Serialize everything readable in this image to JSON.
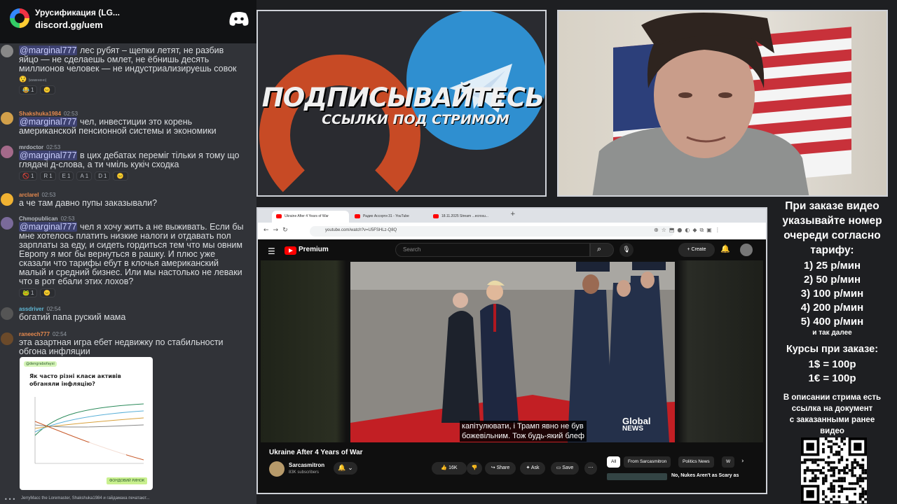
{
  "server": {
    "name": "Урусификация (LG...",
    "invite": "discord.gg/uem"
  },
  "messages": [
    {
      "user": "",
      "time": "",
      "name_color": "#b5bac1",
      "avatar_color": "#888888",
      "mention": "@marginal777",
      "lines": [
        "лес рубят – щепки летят, не разбив",
        "яйцо — не сделаешь омлет, не ёбнишь десять",
        "миллионов человек — не индустриализируешь совок"
      ],
      "note": "(изменено)",
      "reactions": [
        {
          "emoji": "😂",
          "count": "1"
        },
        {
          "emoji": "😐",
          "count": ""
        }
      ]
    },
    {
      "user": "Shakshuka1984",
      "time": "02:53",
      "name_color": "#e78a4e",
      "avatar_color": "#d2a04a",
      "mention": "@marginal777",
      "lines": [
        "чел, инвестиции это корень",
        "американской пенсионной системы и экономики"
      ],
      "reactions": []
    },
    {
      "user": "mrdoctor",
      "time": "02:53",
      "name_color": "#b5bac1",
      "avatar_color": "#a46a8a",
      "mention": "@marginal777",
      "lines": [
        "в цих дебатах переміг тільки я тому що",
        "глядачі д-слова, а ти чміль кукіч сходка"
      ],
      "reactions": [
        {
          "emoji": "🚫",
          "count": "1"
        },
        {
          "emoji": "R",
          "count": "1"
        },
        {
          "emoji": "E",
          "count": "1"
        },
        {
          "emoji": "A",
          "count": "1"
        },
        {
          "emoji": "D",
          "count": "1"
        },
        {
          "emoji": "😐",
          "count": ""
        }
      ]
    },
    {
      "user": "arclarel",
      "time": "02:53",
      "name_color": "#e78a4e",
      "avatar_color": "#f0b232",
      "mention": "",
      "lines": [
        "а че там давно пупы заказывали?"
      ],
      "reactions": []
    },
    {
      "user": "Chmopublican",
      "time": "02:53",
      "name_color": "#b5bac1",
      "avatar_color": "#7a6a9a",
      "mention": "@marginal777",
      "lines": [
        "чел я хочу жить а не выживать. Если бы",
        "мне хотелось платить низкие налоги и отдавать пол",
        "зарплаты за еду, и сидеть гордиться тем что мы овним",
        "Европу я мог бы вернуться в рашку. И плюс уже",
        "сказали что тарифы ебут в клочья американский",
        "малый и средний бизнес. Или мы настолько не леваки",
        "что в рот ебали этих лохов?"
      ],
      "reactions": [
        {
          "emoji": "🐸",
          "count": "1"
        },
        {
          "emoji": "😐",
          "count": ""
        }
      ]
    },
    {
      "user": "assdriver",
      "time": "02:54",
      "name_color": "#5fb8d6",
      "avatar_color": "#555555",
      "mention": "",
      "lines": [
        "богатий папа руский мама"
      ],
      "reactions": []
    },
    {
      "user": "raneech777",
      "time": "02:54",
      "name_color": "#e78a4e",
      "avatar_color": "#6b4a2a",
      "mention": "",
      "lines": [
        "эта азартная игра ебет недвижку по стабильности",
        "обгона инфляции"
      ],
      "reactions": []
    }
  ],
  "embed": {
    "handle": "@dengrabofaysi",
    "title": "Як часто різні класи активів обганяли інфляцію?",
    "badge": "ФОНДОВИЙ РИНОК"
  },
  "typing": "JerryMacc the Loremaster, Shakshuka1984 и гайдамака печатают...",
  "promo": {
    "line1": "ПОДПИСЫВАЙТЕСЬ",
    "line2": "ССЫЛКИ ПОД СТРИМОМ"
  },
  "browser": {
    "tabs": [
      "Ukraine After 4 Years of War",
      "Радио Ассорти 31 - YouTube",
      "18.11.2025 Stream ...ecrosu..."
    ],
    "url": "youtube.com/watch?v=U5FSHLz-Q8Q"
  },
  "youtube": {
    "brand": "Premium",
    "search_placeholder": "Search",
    "create": "Create",
    "video_title": "Ukraine After 4 Years of War",
    "channel": "Sarcasmitron",
    "subscribers": "83K subscribers",
    "likes": "16K",
    "share": "Share",
    "ask": "Ask",
    "save": "Save",
    "chips": [
      "All",
      "From Sarcasmitron",
      "Politics News",
      "W"
    ],
    "rec_title": "No, Nukes Aren't as Scary as",
    "subtitle_lines": [
      "капітулювати, і Трамп явно не був",
      "божевільним.  Тож будь-який блеф"
    ],
    "watermark1": "Global",
    "watermark2": "NEWS"
  },
  "info": {
    "order_lines": [
      "При заказе видео",
      "указывайте номер",
      "очереди согласно",
      "тарифу:"
    ],
    "prices": [
      "1) 25 р/мин",
      "2) 50 р/мин",
      "3) 100 р/мин",
      "4) 200 р/мин",
      "5) 400 р/мин"
    ],
    "more": "и так далее",
    "rates_title": "Курсы при заказе:",
    "rates": [
      "1$ = 100р",
      "1€ = 100р"
    ],
    "desc_lines": [
      "В описании стрима есть",
      "ссылка на документ",
      "с заказанными ранее",
      "видео"
    ]
  }
}
